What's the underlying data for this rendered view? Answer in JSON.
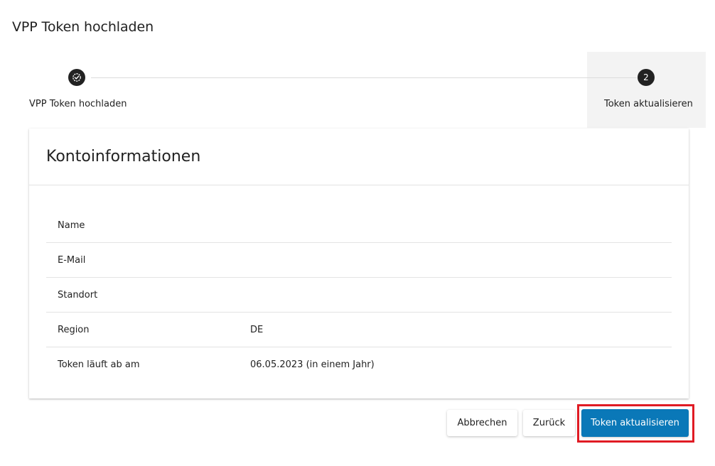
{
  "dialog": {
    "title": "VPP Token hochladen"
  },
  "stepper": {
    "steps": [
      {
        "number": "",
        "label": "VPP Token hochladen",
        "state": "completed",
        "icon": "check-circle-icon"
      },
      {
        "number": "2",
        "label": "Token aktualisieren",
        "state": "active"
      }
    ]
  },
  "card": {
    "title": "Kontoinformationen",
    "rows": [
      {
        "label": "Name",
        "value": ""
      },
      {
        "label": "E-Mail",
        "value": ""
      },
      {
        "label": "Standort",
        "value": ""
      },
      {
        "label": "Region",
        "value": "DE"
      },
      {
        "label": "Token läuft ab am",
        "value": "06.05.2023 (in einem Jahr)"
      }
    ]
  },
  "footer": {
    "cancel_label": "Abbrechen",
    "back_label": "Zurück",
    "update_label": "Token aktualisieren"
  },
  "colors": {
    "primary": "#0a78b8",
    "highlight": "#e01b24",
    "step_active_bg": "#f3f3f3"
  }
}
